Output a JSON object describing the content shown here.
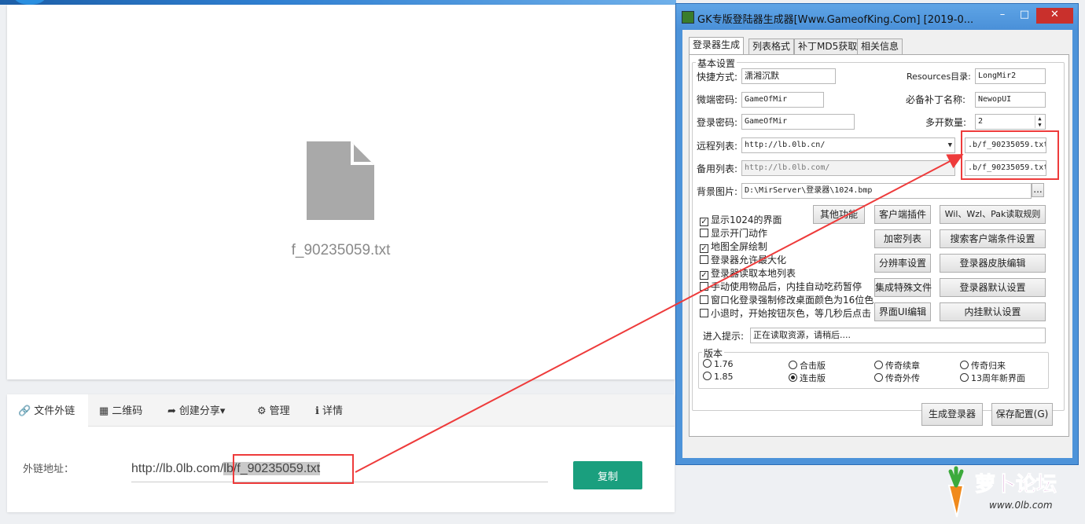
{
  "preview": {
    "file_name": "f_90235059.txt"
  },
  "share": {
    "tabs": [
      {
        "icon": "link-icon",
        "label": "文件外链"
      },
      {
        "icon": "qrcode-icon",
        "label": "二维码"
      },
      {
        "icon": "share-icon",
        "label": "创建分享▾"
      },
      {
        "icon": "gear-icon",
        "label": "管理"
      },
      {
        "icon": "info-icon",
        "label": "详情"
      }
    ],
    "link_label": "外链地址：",
    "url_prefix": "http://lb.0lb.com/",
    "url_highlight": "lb/f_90235059.txt",
    "copy_label": "复制"
  },
  "dialog": {
    "title": "GK专版登陆器生成器[Www.GameofKing.Com] [2019-0...",
    "tabs": [
      "登录器生成",
      "列表格式",
      "补丁MD5获取",
      "相关信息"
    ],
    "group_basic": "基本设置",
    "shortcut_label": "快捷方式:",
    "shortcut_value": "潇湘沉默",
    "resources_label": "Resources目录:",
    "resources_value": "LongMir2",
    "micro_pwd_label": "微端密码:",
    "micro_pwd_value": "GameOfMir",
    "patch_label": "必备补丁名称:",
    "patch_value": "NewopUI",
    "login_pwd_label": "登录密码:",
    "login_pwd_value": "GameOfMir",
    "multi_label": "多开数量:",
    "multi_value": "2",
    "remote_label": "远程列表:",
    "remote_value": "http://lb.0lb.cn/",
    "remote_file": ".b/f_90235059.txt",
    "backup_label": "备用列表:",
    "backup_value": "http://lb.0lb.com/",
    "backup_file": ".b/f_90235059.txt",
    "bg_label": "背景图片:",
    "bg_value": "D:\\MirServer\\登录器\\1024.bmp",
    "bg_browse": "...",
    "checkboxes": [
      {
        "label": "显示1024的界面",
        "checked": true
      },
      {
        "label": "显示开门动作",
        "checked": false
      },
      {
        "label": "地图全屏绘制",
        "checked": true
      },
      {
        "label": "登录器允许最大化",
        "checked": false
      },
      {
        "label": "登录器读取本地列表",
        "checked": true
      },
      {
        "label": "手动使用物品后，内挂自动吃药暂停",
        "checked": false
      },
      {
        "label": "窗口化登录强制修改桌面颜色为16位色",
        "checked": false
      },
      {
        "label": "小退时，开始按钮灰色，等几秒后点击",
        "checked": false
      }
    ],
    "buttons": {
      "other": "其他功能",
      "client_plugin": "客户端插件",
      "read_rules": "Wil、Wzl、Pak读取规则",
      "encrypt_list": "加密列表",
      "search_client": "搜索客户端条件设置",
      "resolution": "分辨率设置",
      "skin_edit": "登录器皮肤编辑",
      "special_files": "集成特殊文件",
      "default_settings": "登录器默认设置",
      "ui_edit": "界面UI编辑",
      "plugin_default": "内挂默认设置",
      "generate": "生成登录器",
      "save_config": "保存配置(G)"
    },
    "hint_label": "进入提示:",
    "hint_value": "正在读取资源，请稍后....",
    "version_label": "版本",
    "versions": [
      {
        "label": "1.76",
        "selected": false
      },
      {
        "label": "合击版",
        "selected": false
      },
      {
        "label": "传奇续章",
        "selected": false
      },
      {
        "label": "传奇归来",
        "selected": false
      },
      {
        "label": "1.85",
        "selected": false
      },
      {
        "label": "连击版",
        "selected": true
      },
      {
        "label": "传奇外传",
        "selected": false
      },
      {
        "label": "13周年新界面",
        "selected": false
      }
    ],
    "win_buttons": {
      "minimize": "–",
      "maximize": "□",
      "close": "✕"
    }
  },
  "watermark": {
    "text": "萝卜论坛",
    "sub": "www.0lb.com"
  }
}
